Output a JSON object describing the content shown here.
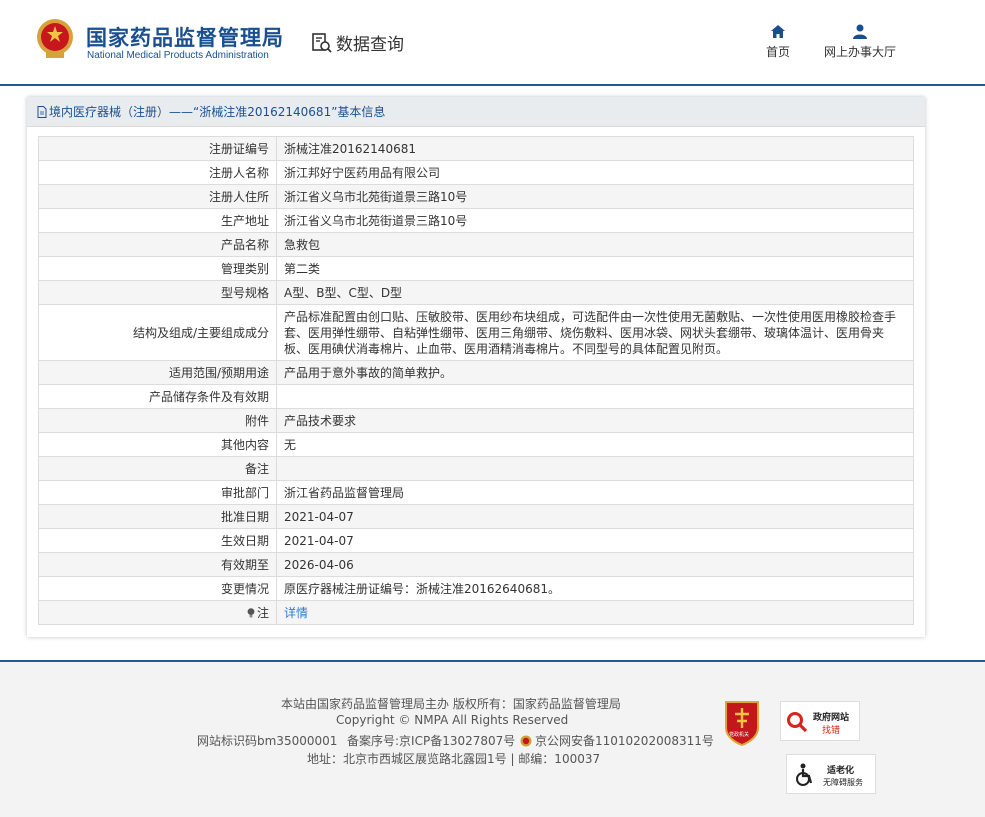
{
  "header": {
    "brand_cn": "国家药品监督管理局",
    "brand_en": "National Medical Products Administration",
    "section_title": "数据查询",
    "nav": {
      "home": "首页",
      "hall": "网上办事大厅"
    },
    "colors": {
      "brand": "#1a4f8f",
      "rule": "#1f5a93"
    }
  },
  "panel": {
    "title": "境内医疗器械（注册）——“浙械注准20162140681”基本信息"
  },
  "rows": [
    {
      "label": "注册证编号",
      "value": "浙械注准20162140681"
    },
    {
      "label": "注册人名称",
      "value": "浙江邦好宁医药用品有限公司"
    },
    {
      "label": "注册人住所",
      "value": "浙江省义乌市北苑街道景三路10号"
    },
    {
      "label": "生产地址",
      "value": "浙江省义乌市北苑街道景三路10号"
    },
    {
      "label": "产品名称",
      "value": "急救包"
    },
    {
      "label": "管理类别",
      "value": "第二类"
    },
    {
      "label": "型号规格",
      "value": "A型、B型、C型、D型"
    },
    {
      "label": "结构及组成/主要组成成分",
      "value": "产品标准配置由创口贴、压敏胶带、医用纱布块组成，可选配件由一次性使用无菌敷贴、一次性使用医用橡胶检查手套、医用弹性绷带、自粘弹性绷带、医用三角绷带、烧伤敷料、医用冰袋、网状头套绷带、玻璃体温计、医用骨夹板、医用碘伏消毒棉片、止血带、医用酒精消毒棉片。不同型号的具体配置见附页。"
    },
    {
      "label": "适用范围/预期用途",
      "value": "产品用于意外事故的简单救护。"
    },
    {
      "label": "产品储存条件及有效期",
      "value": ""
    },
    {
      "label": "附件",
      "value": "产品技术要求"
    },
    {
      "label": "其他内容",
      "value": "无"
    },
    {
      "label": "备注",
      "value": ""
    },
    {
      "label": "审批部门",
      "value": "浙江省药品监督管理局"
    },
    {
      "label": "批准日期",
      "value": "2021-04-07"
    },
    {
      "label": "生效日期",
      "value": "2021-04-07"
    },
    {
      "label": "有效期至",
      "value": "2026-04-06"
    },
    {
      "label": "变更情况",
      "value": "原医疗器械注册证编号：浙械注准20162640681。"
    }
  ],
  "note_row": {
    "label": "注",
    "link": "详情"
  },
  "footer": {
    "line1": "本站由国家药品监督管理局主办 版权所有：国家药品监督管理局",
    "line2": "Copyright © NMPA All Rights Reserved",
    "site_id": "网站标识码bm35000001",
    "icp": "备案序号:京ICP备13027807号",
    "police": "京公网安备11010202008311号",
    "address": "地址：北京市西城区展览路北露园1号 | 邮编：100037",
    "badges": {
      "party_text": "党政机关",
      "find_error_title": "政府网站",
      "find_error_sub": "找错",
      "elder_title": "适老化",
      "elder_sub": "无障碍服务"
    }
  }
}
